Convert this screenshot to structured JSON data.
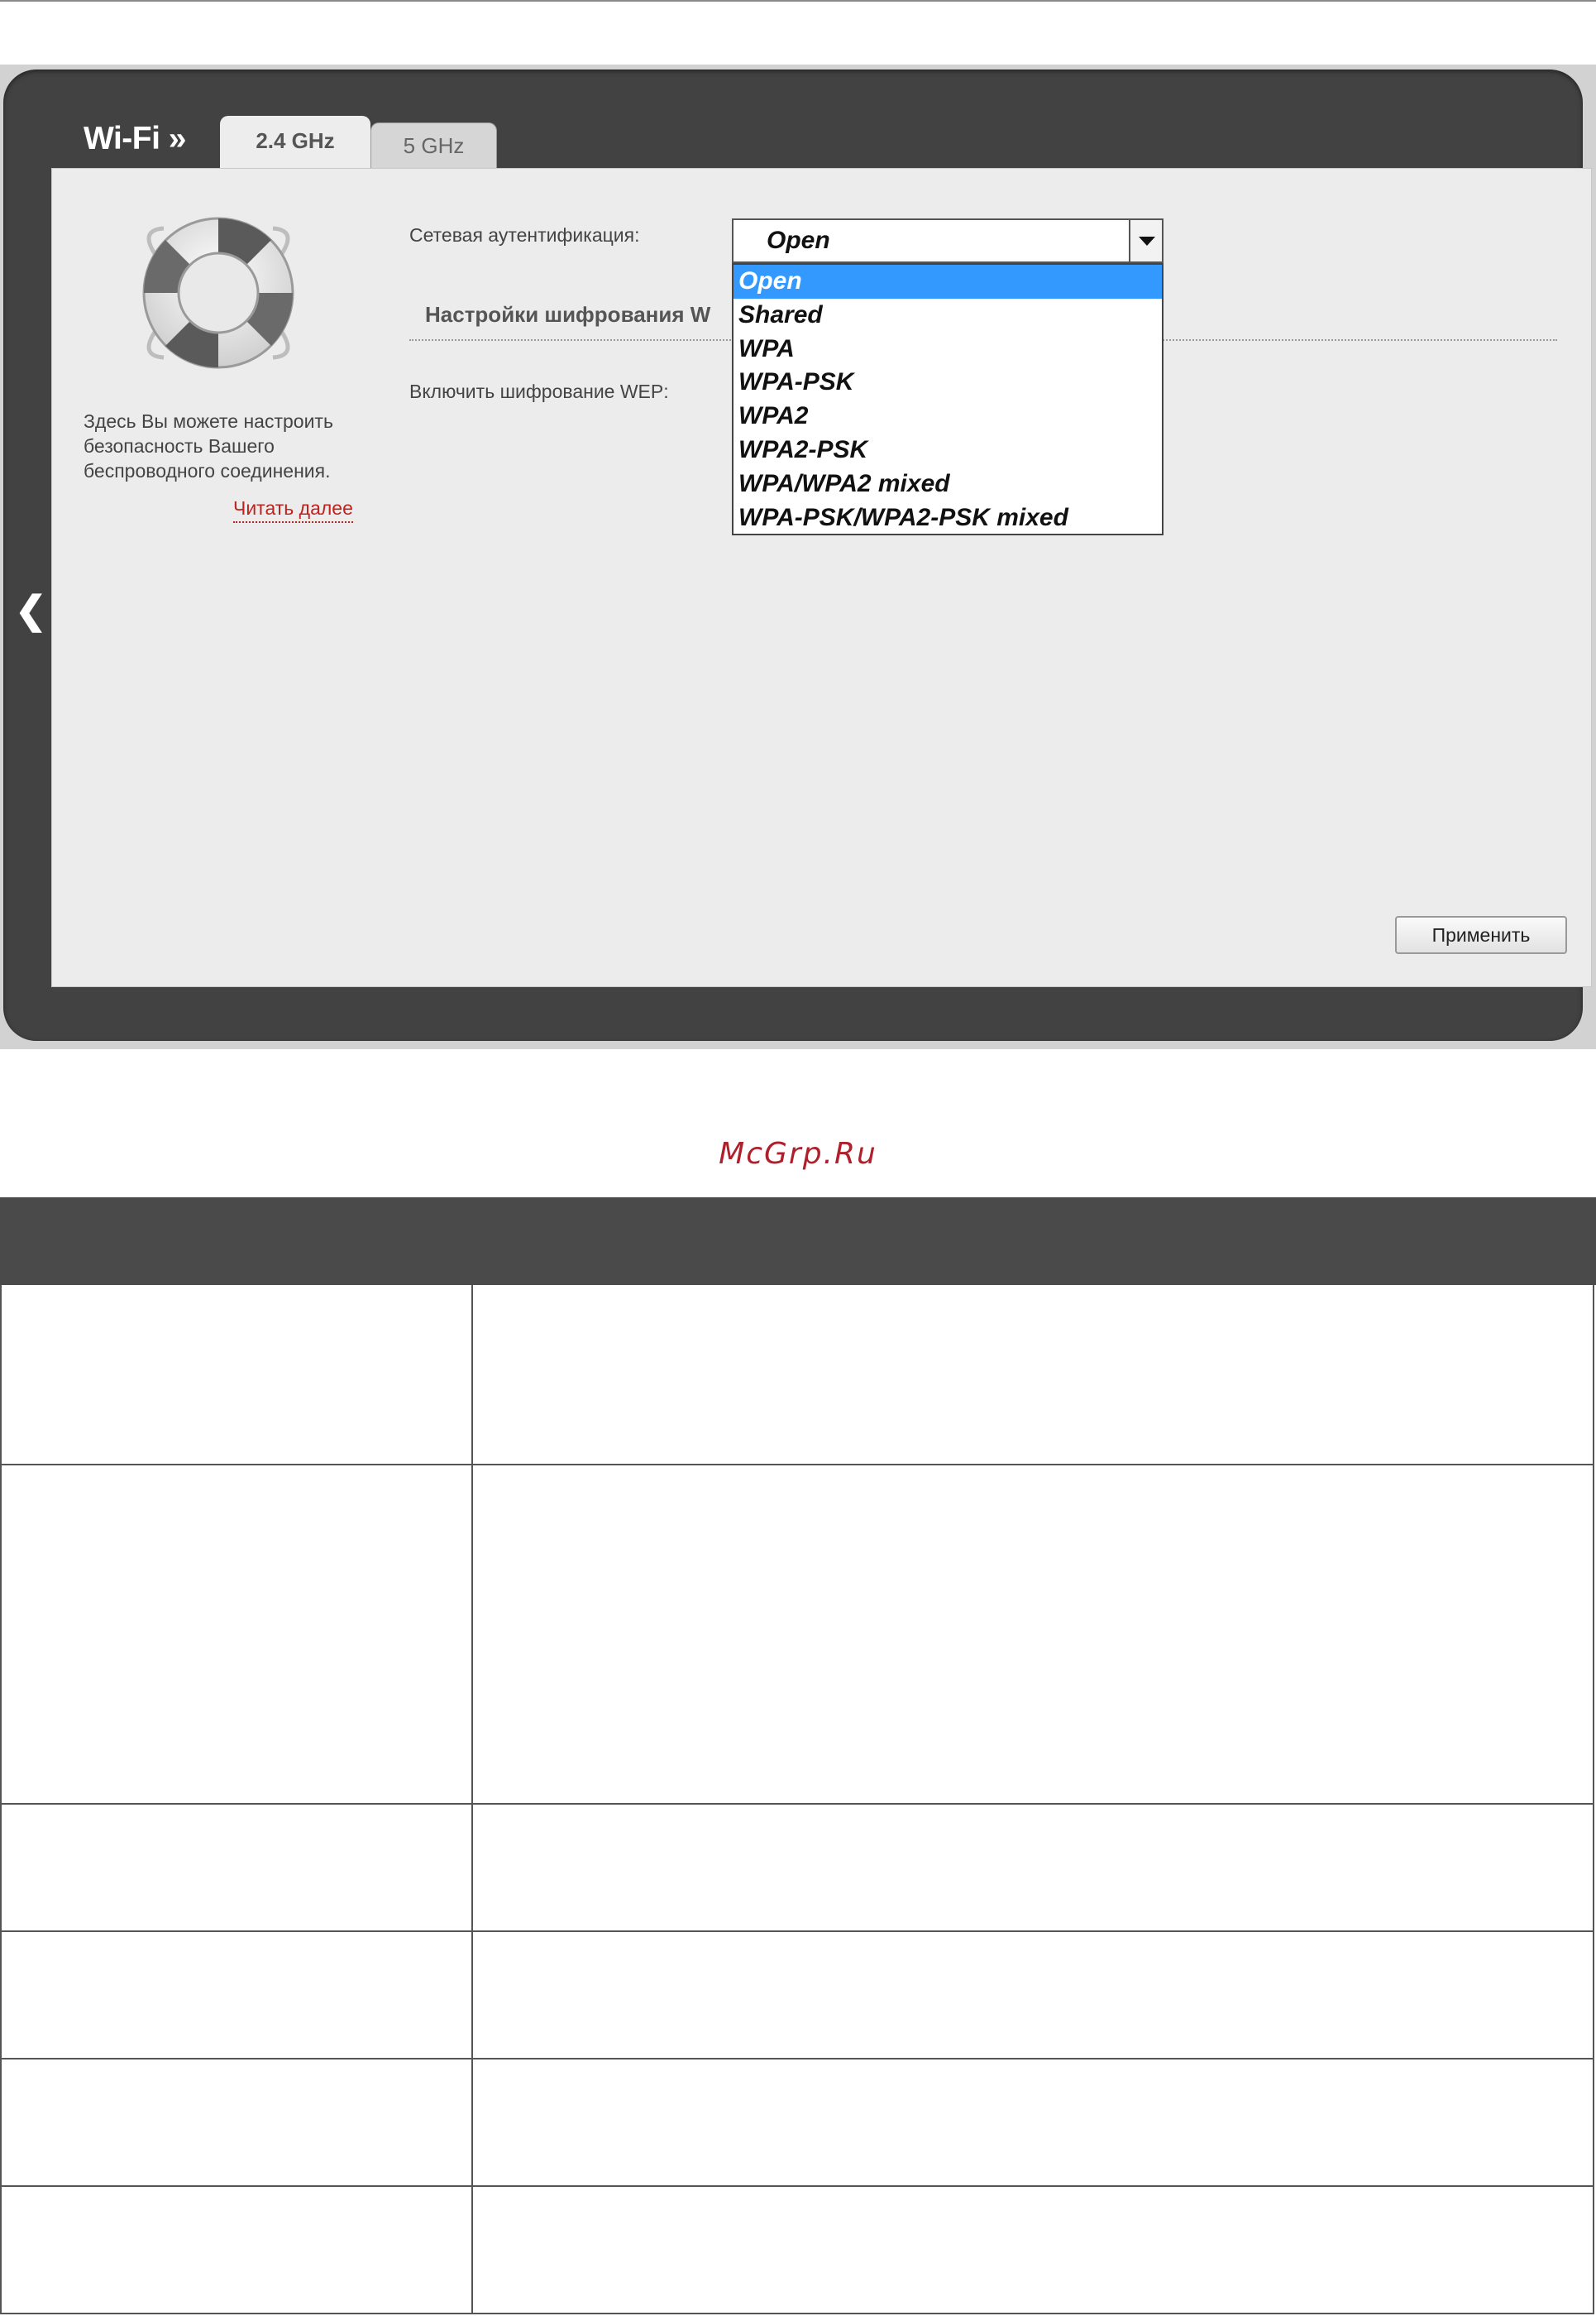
{
  "header": {
    "section_title": "Wi-Fi »",
    "tabs": [
      {
        "label": "2.4 GHz",
        "active": true
      },
      {
        "label": "5 GHz",
        "active": false
      }
    ]
  },
  "sidebar": {
    "help_text": "Здесь Вы можете настроить безопасность Вашего беспроводного соединения.",
    "read_more": "Читать далее"
  },
  "form": {
    "auth_label": "Сетевая аутентификация:",
    "auth_selected": "Open",
    "auth_options": [
      "Open",
      "Shared",
      "WPA",
      "WPA-PSK",
      "WPA2",
      "WPA2-PSK",
      "WPA/WPA2 mixed",
      "WPA-PSK/WPA2-PSK mixed"
    ],
    "encryption_section": "Настройки шифрования W",
    "wep_label": "Включить шифрование WEP:",
    "apply_button": "Применить"
  },
  "page": {
    "watermark": "McGrp.Ru"
  },
  "colors": {
    "panel_dark": "#424242",
    "content_bg": "#ececec",
    "selection_blue": "#3399ff",
    "link_red": "#c0221d",
    "table_header": "#4a4a4a"
  }
}
